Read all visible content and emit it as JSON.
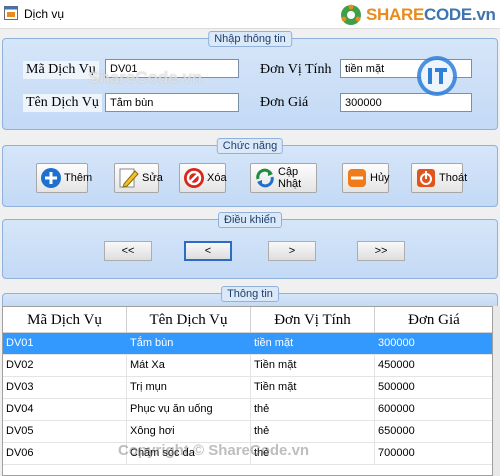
{
  "window": {
    "title": "Dịch vụ"
  },
  "brand": {
    "share": "SHARE",
    "code": "CODE.vn"
  },
  "watermarks": {
    "center": "ShareCode.vn",
    "bottom": "Copyright © ShareCode.vn"
  },
  "input_panel": {
    "legend": "Nhập thông tin",
    "ma_label": "Mã Dịch Vụ",
    "ma_value": "DV01",
    "ten_label": "Tên Dịch Vụ",
    "ten_value": "Tắm bùn",
    "dvt_label": "Đơn Vị Tính",
    "dvt_value": "tiền mặt",
    "gia_label": "Đơn Giá",
    "gia_value": "300000"
  },
  "function_panel": {
    "legend": "Chức năng",
    "buttons": [
      {
        "label": "Thêm",
        "icon": "add-icon"
      },
      {
        "label": "Sửa",
        "icon": "edit-icon"
      },
      {
        "label": "Xóa",
        "icon": "delete-icon"
      },
      {
        "label": "Cập Nhật",
        "icon": "refresh-icon"
      },
      {
        "label": "Hủy",
        "icon": "cancel-icon"
      },
      {
        "label": "Thoát",
        "icon": "exit-icon"
      }
    ]
  },
  "control_panel": {
    "legend": "Điều khiển",
    "first": "<<",
    "prev": "<",
    "next": ">",
    "last": ">>"
  },
  "info_panel": {
    "legend": "Thông tin"
  },
  "table": {
    "headers": [
      "Mã Dịch Vụ",
      "Tên Dịch Vụ",
      "Đơn Vị Tính",
      "Đơn Giá"
    ],
    "rows": [
      [
        "DV01",
        "Tắm bùn",
        "tiền mặt",
        "300000"
      ],
      [
        "DV02",
        "Mát Xa",
        "Tiền mặt",
        "450000"
      ],
      [
        "DV03",
        "Trị mụn",
        "Tiền mặt",
        "500000"
      ],
      [
        "DV04",
        "Phục vụ ăn uống",
        "thẻ",
        "600000"
      ],
      [
        "DV05",
        "Xông hơi",
        "thẻ",
        "650000"
      ],
      [
        "DV06",
        "Chăm sóc da",
        "thẻ",
        "700000"
      ]
    ],
    "selected_row": 0
  },
  "colors": {
    "selection": "#3399ff",
    "panel": "#c3d9f5",
    "brand_orange": "#e98b1d"
  }
}
